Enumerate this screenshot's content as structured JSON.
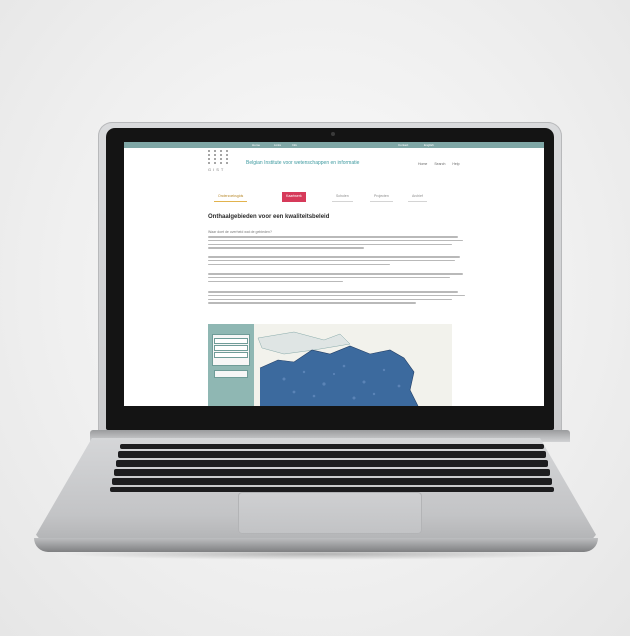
{
  "site": {
    "logo_letters": "GIST",
    "title": "Belgian Institute voor wetenschappen en informatie",
    "util_links": [
      "Home",
      "Search",
      "Help"
    ],
    "top_nav": [
      "Home",
      "Links",
      "Info",
      "Contact",
      "English"
    ],
    "tabs": [
      {
        "label": "Onderzoeksgids",
        "style": "yellow"
      },
      {
        "label": "Kaartwerk",
        "style": "active"
      },
      {
        "label": "Scholen",
        "style": "plain"
      },
      {
        "label": "Projecten",
        "style": "plain"
      },
      {
        "label": "Archief",
        "style": "plain"
      }
    ],
    "page_heading": "Onthaalgebieden voor een kwaliteitsbeleid",
    "sub_heading": "Waar doet de overheid wat de gebieden?"
  },
  "colors": {
    "accent_teal": "#3e9aa0",
    "active_tab": "#d63a5a",
    "map_fill": "#3c6a9e",
    "panel": "#8fb7b3"
  }
}
